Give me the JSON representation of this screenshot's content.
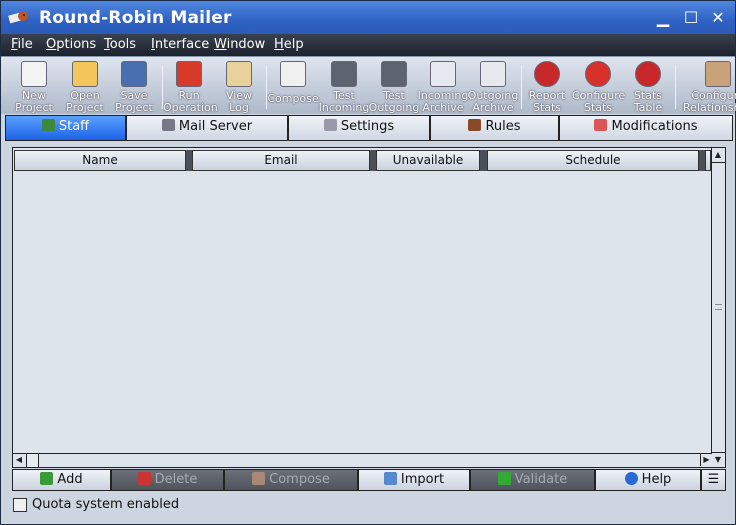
{
  "window": {
    "title": "Round-Robin Mailer",
    "controls": [
      "minimize",
      "maximize",
      "close"
    ]
  },
  "menu": [
    {
      "label": "File",
      "u": "F",
      "rest": "ile"
    },
    {
      "label": "Options",
      "u": "O",
      "rest": "ptions"
    },
    {
      "label": "Tools",
      "u": "T",
      "rest": "ools"
    },
    {
      "label": "Interface",
      "u": "I",
      "rest": "nterface"
    },
    {
      "label": "Window",
      "u": "W",
      "rest": "indow"
    },
    {
      "label": "Help",
      "u": "H",
      "rest": "elp"
    }
  ],
  "toolbar": [
    {
      "l1": "New",
      "l2": "Project",
      "icon": "new-document-icon",
      "color": "#f4f4f4"
    },
    {
      "l1": "Open",
      "l2": "Project",
      "icon": "open-folder-icon",
      "color": "#f2c65a"
    },
    {
      "l1": "Save",
      "l2": "Project",
      "icon": "floppy-disk-icon",
      "color": "#4a6fb0"
    },
    {
      "l1": "Run",
      "l2": "Operation",
      "icon": "run-arrows-icon",
      "color": "#d83a2a"
    },
    {
      "l1": "View",
      "l2": "Log",
      "icon": "scroll-icon",
      "color": "#e8d19a"
    },
    {
      "l1": "Compose",
      "l2": "",
      "icon": "compose-pencil-icon",
      "color": "#f0f0f0"
    },
    {
      "l1": "Test",
      "l2": "Incoming",
      "icon": "test-incoming-icon",
      "color": "#5c6470"
    },
    {
      "l1": "Test",
      "l2": "Outgoing",
      "icon": "test-outgoing-icon",
      "color": "#5c6470"
    },
    {
      "l1": "Incoming",
      "l2": "Archive",
      "icon": "incoming-archive-icon",
      "color": "#e6e9ee"
    },
    {
      "l1": "Outgoing",
      "l2": "Archive",
      "icon": "outgoing-archive-icon",
      "color": "#e6e9ee"
    },
    {
      "l1": "Report",
      "l2": "Stats",
      "icon": "pie-chart-icon",
      "color": "#c8282a"
    },
    {
      "l1": "Configure",
      "l2": "Stats",
      "icon": "pie-chart-gear-icon",
      "color": "#d8302a"
    },
    {
      "l1": "Stats",
      "l2": "Table",
      "icon": "pie-chart-table-icon",
      "color": "#c8282a"
    },
    {
      "l1": "Configure",
      "l2": "Relationships",
      "icon": "handshake-gear-icon",
      "color": "#c9a27a"
    }
  ],
  "tabs": [
    {
      "label": "Staff",
      "icon": "staff-people-icon",
      "active": true
    },
    {
      "label": "Mail Server",
      "icon": "mail-server-icon"
    },
    {
      "label": "Settings",
      "icon": "settings-gear-icon"
    },
    {
      "label": "Rules",
      "icon": "gavel-icon"
    },
    {
      "label": "Modifications",
      "icon": "modifications-icon"
    }
  ],
  "table": {
    "columns": [
      "Name",
      "Email",
      "Unavailable",
      "Schedule"
    ],
    "rows": []
  },
  "buttons": [
    {
      "label": "Add",
      "icon": "add-icon",
      "enabled": true
    },
    {
      "label": "Delete",
      "icon": "delete-icon",
      "enabled": false
    },
    {
      "label": "Compose",
      "icon": "compose-icon",
      "enabled": false
    },
    {
      "label": "Import",
      "icon": "import-icon",
      "enabled": true
    },
    {
      "label": "Validate",
      "icon": "validate-check-icon",
      "enabled": false
    },
    {
      "label": "Help",
      "icon": "help-icon",
      "enabled": true
    }
  ],
  "quota": {
    "label": "Quota system enabled",
    "checked": false
  },
  "colors": {
    "titlebar": "#2f62c4",
    "active_tab": "#1d62e6",
    "disabled_button": "#5a5e66"
  }
}
